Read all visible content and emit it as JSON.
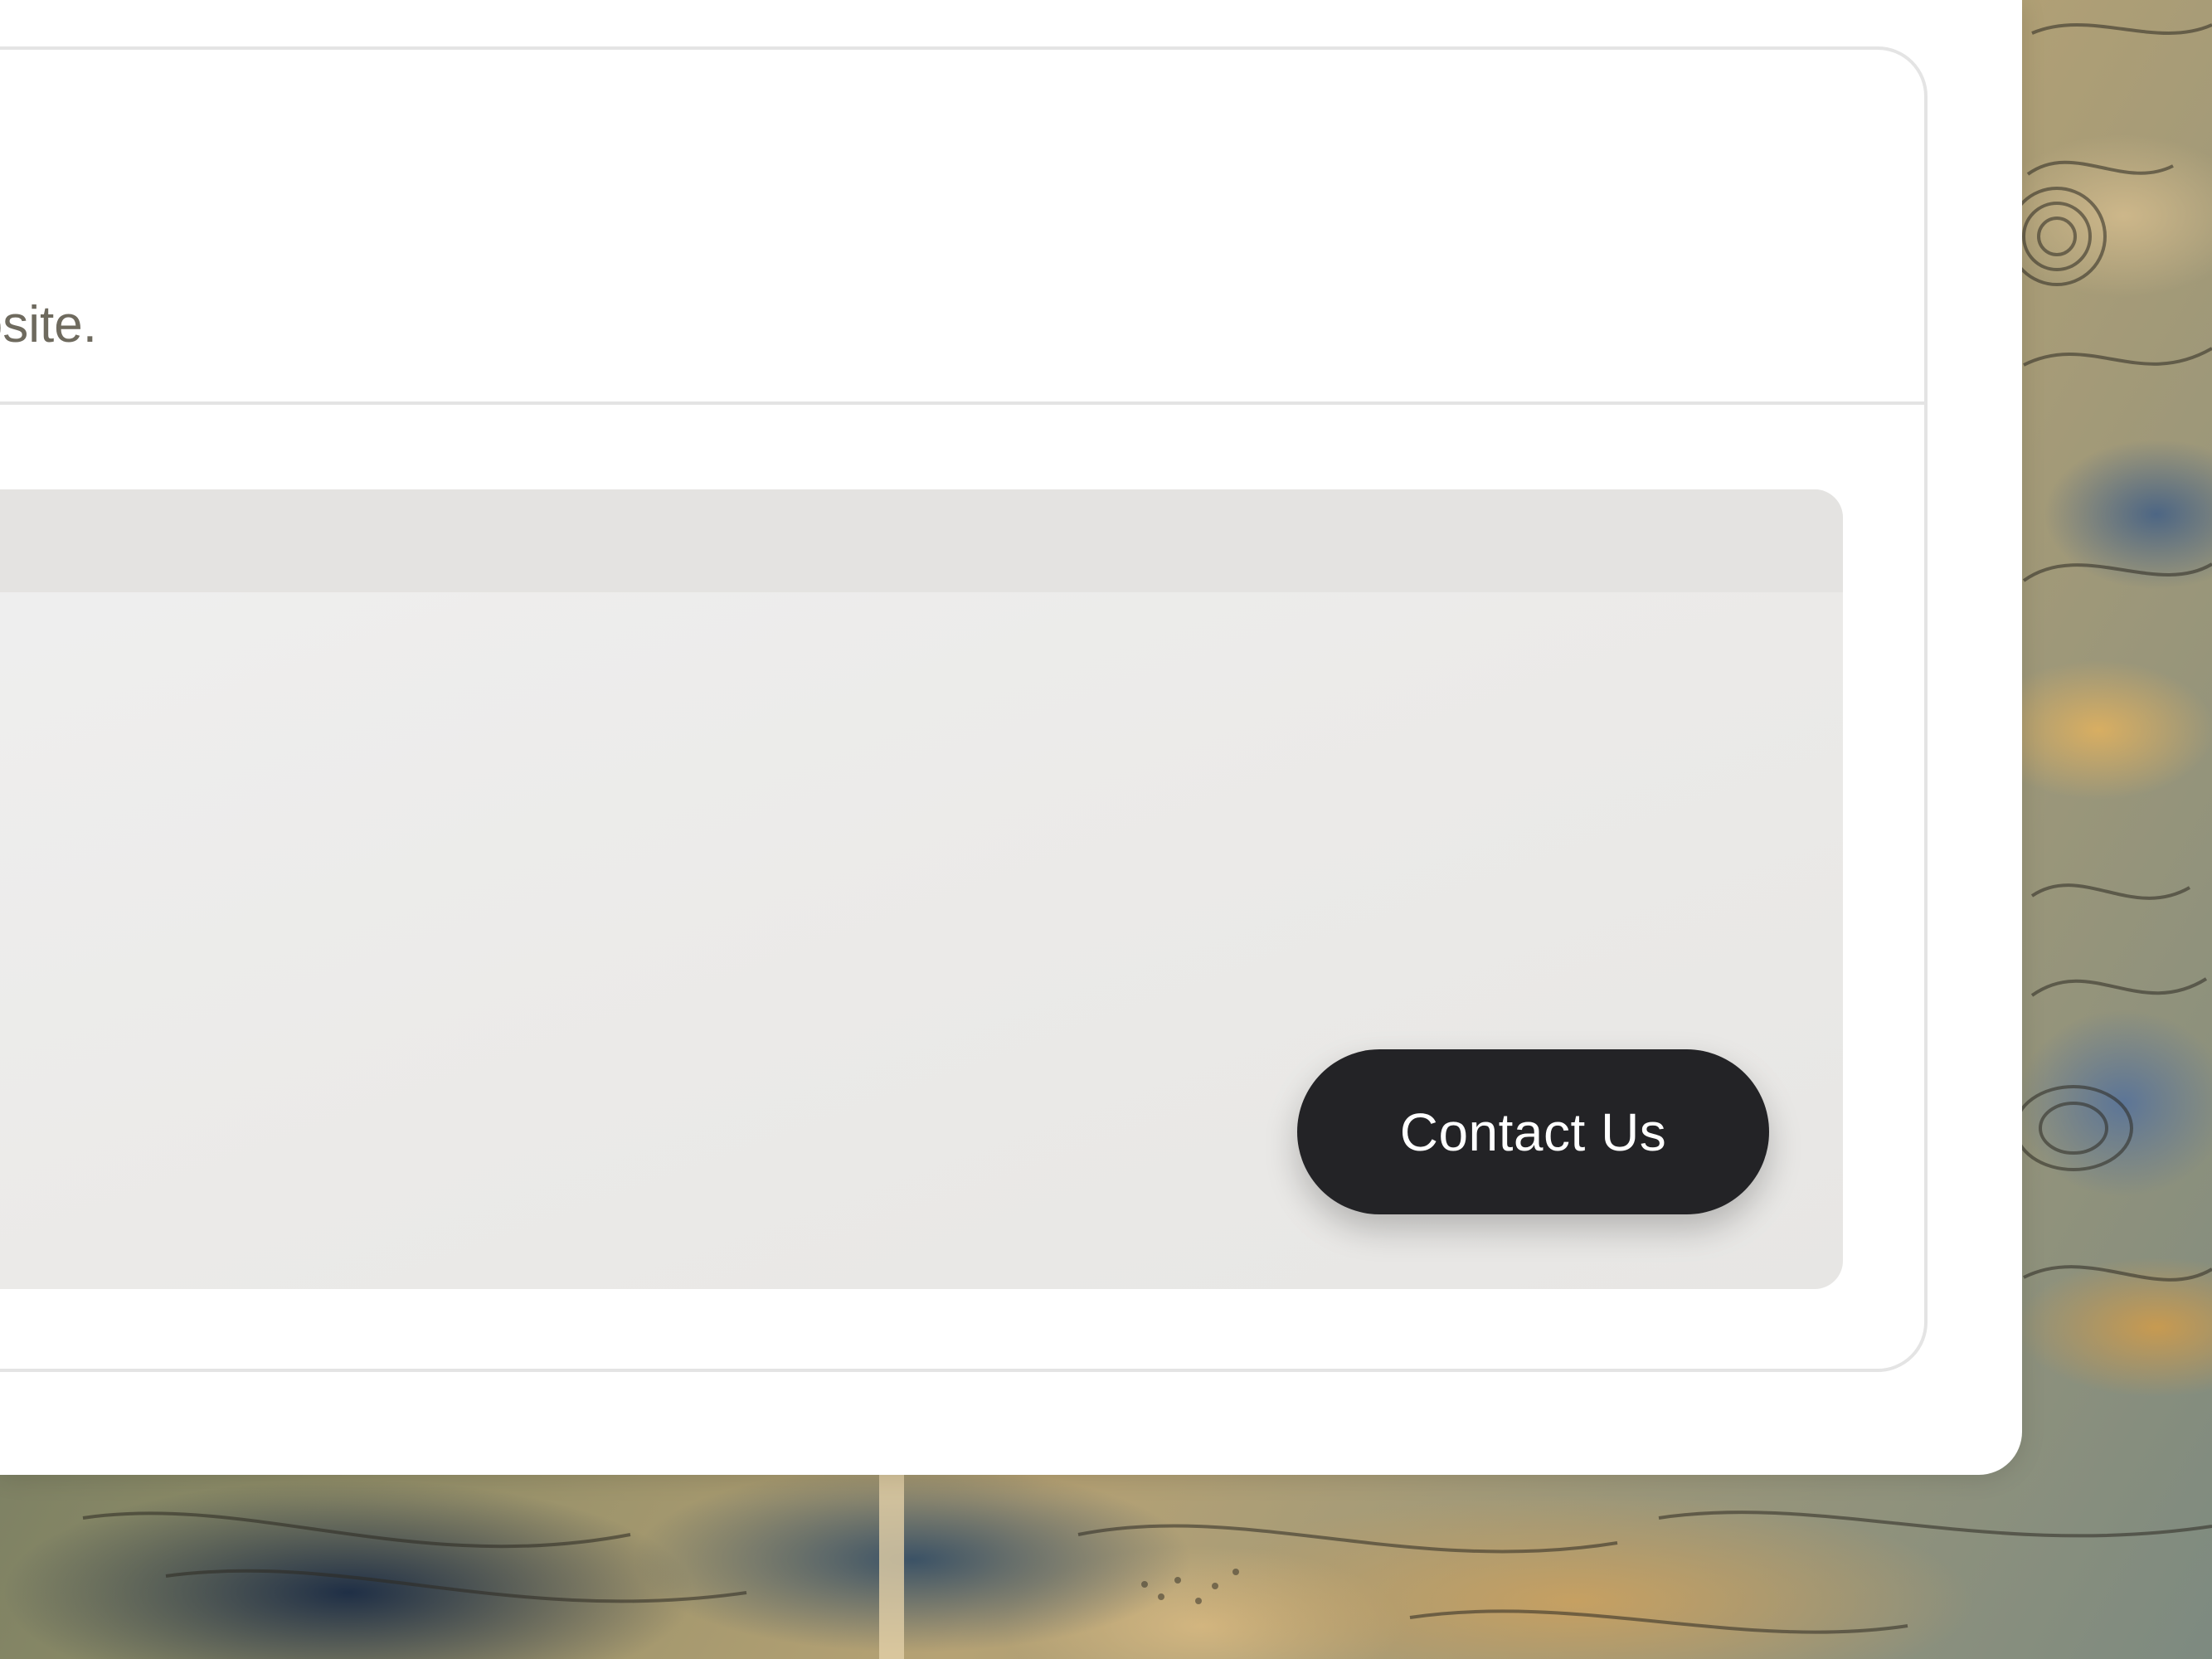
{
  "card": {
    "description_fragment": "osite."
  },
  "preview": {
    "contact_button_label": "Contact Us"
  },
  "colors": {
    "panel_background": "#ffffff",
    "card_border": "#e4e4e4",
    "preview_background": "#ebeae8",
    "preview_topbar": "#e4e3e1",
    "button_background": "#232326",
    "button_text": "#ffffff",
    "description_text": "#6e6a5e"
  }
}
